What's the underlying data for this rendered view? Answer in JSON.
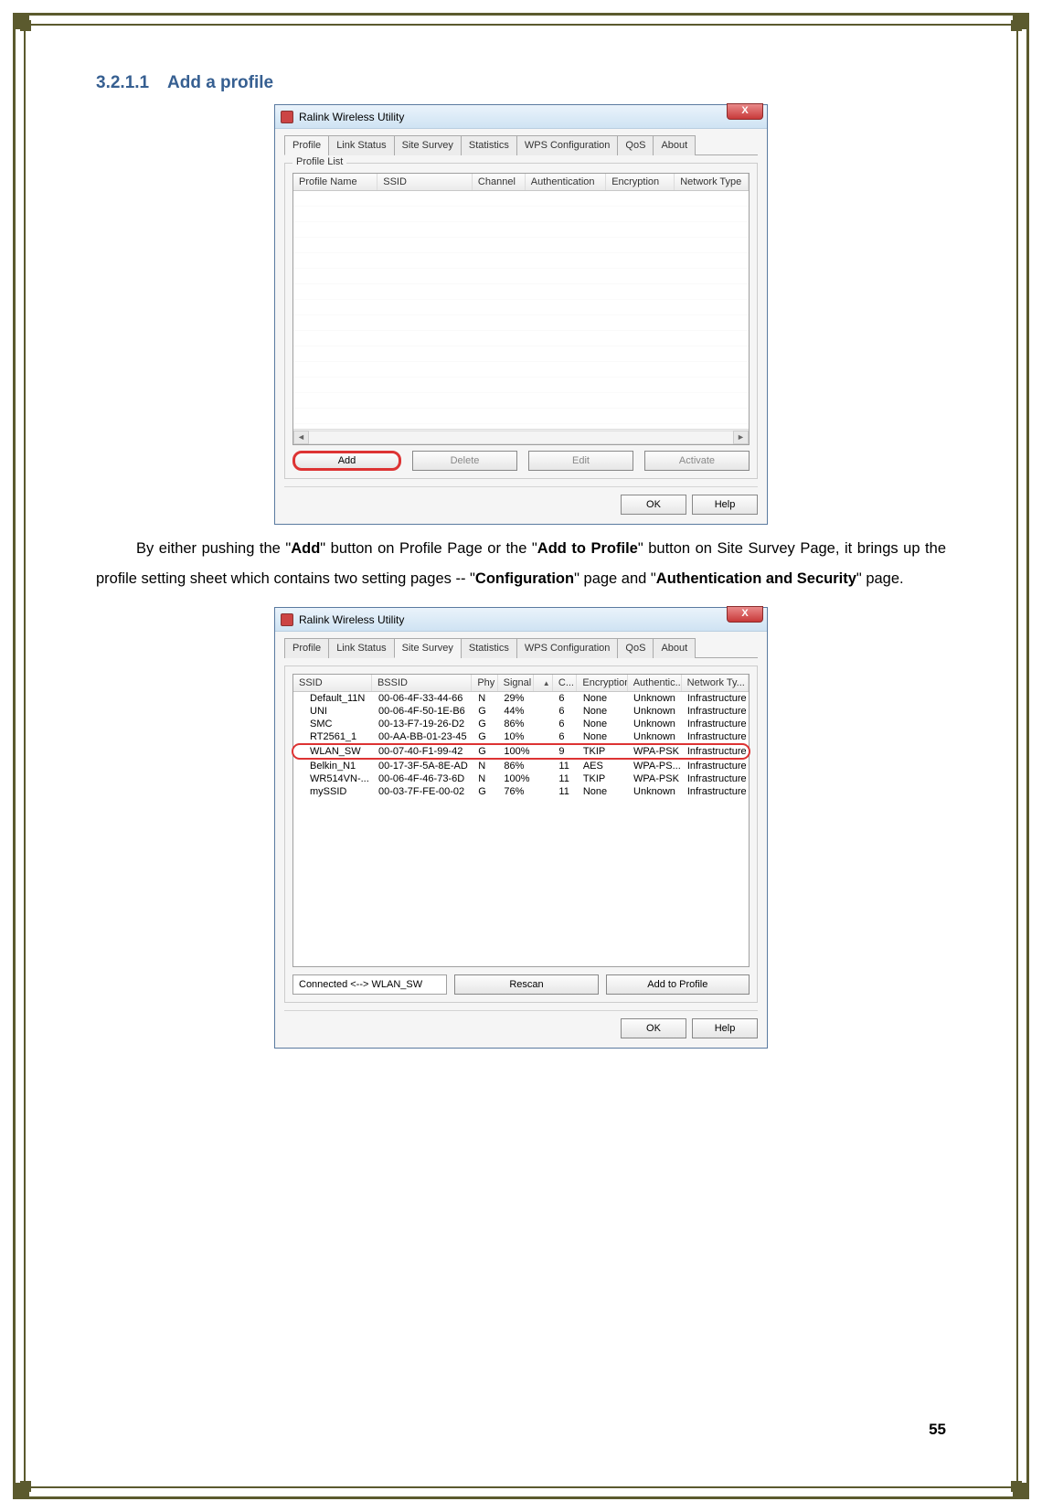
{
  "section": {
    "number": "3.2.1.1",
    "title": "Add a profile"
  },
  "paragraph": {
    "t1": "By either pushing the \"",
    "b1": "Add",
    "t2": "\" button on Profile Page or the \"",
    "b2": "Add to Profile",
    "t3": "\" button on Site Survey Page, it brings up the profile setting sheet which contains two setting pages -- \"",
    "b3": "Configuration",
    "t4": "\" page and \"",
    "b4": "Authentication and Security",
    "t5": "\" page."
  },
  "page_number": "55",
  "win1": {
    "title": "Ralink Wireless Utility",
    "close": "X",
    "tabs": [
      "Profile",
      "Link Status",
      "Site Survey",
      "Statistics",
      "WPS Configuration",
      "QoS",
      "About"
    ],
    "active_tab": "Profile",
    "group_label": "Profile List",
    "columns": [
      "Profile Name",
      "SSID",
      "Channel",
      "Authentication",
      "Encryption",
      "Network Type"
    ],
    "buttons": {
      "add": "Add",
      "delete": "Delete",
      "edit": "Edit",
      "activate": "Activate"
    },
    "footer": {
      "ok": "OK",
      "help": "Help"
    }
  },
  "win2": {
    "title": "Ralink Wireless Utility",
    "close": "X",
    "tabs": [
      "Profile",
      "Link Status",
      "Site Survey",
      "Statistics",
      "WPS Configuration",
      "QoS",
      "About"
    ],
    "active_tab": "Site Survey",
    "columns": [
      "SSID",
      "BSSID",
      "Phy",
      "Signal",
      "",
      "C...",
      "Encryption",
      "Authentic...",
      "Network Ty..."
    ],
    "rows": [
      {
        "ssid": "Default_11N",
        "bssid": "00-06-4F-33-44-66",
        "phy": "N",
        "signal": "29%",
        "sort": "",
        "c": "6",
        "enc": "None",
        "auth": "Unknown",
        "nt": "Infrastructure"
      },
      {
        "ssid": "UNI",
        "bssid": "00-06-4F-50-1E-B6",
        "phy": "G",
        "signal": "44%",
        "sort": "",
        "c": "6",
        "enc": "None",
        "auth": "Unknown",
        "nt": "Infrastructure"
      },
      {
        "ssid": "SMC",
        "bssid": "00-13-F7-19-26-D2",
        "phy": "G",
        "signal": "86%",
        "sort": "",
        "c": "6",
        "enc": "None",
        "auth": "Unknown",
        "nt": "Infrastructure"
      },
      {
        "ssid": "RT2561_1",
        "bssid": "00-AA-BB-01-23-45",
        "phy": "G",
        "signal": "10%",
        "sort": "",
        "c": "6",
        "enc": "None",
        "auth": "Unknown",
        "nt": "Infrastructure"
      },
      {
        "ssid": "WLAN_SW",
        "bssid": "00-07-40-F1-99-42",
        "phy": "G",
        "signal": "100%",
        "sort": "",
        "c": "9",
        "enc": "TKIP",
        "auth": "WPA-PSK",
        "nt": "Infrastructure",
        "highlight": true
      },
      {
        "ssid": "Belkin_N1",
        "bssid": "00-17-3F-5A-8E-AD",
        "phy": "N",
        "signal": "86%",
        "sort": "",
        "c": "11",
        "enc": "AES",
        "auth": "WPA-PS...",
        "nt": "Infrastructure"
      },
      {
        "ssid": "WR514VN-...",
        "bssid": "00-06-4F-46-73-6D",
        "phy": "N",
        "signal": "100%",
        "sort": "",
        "c": "11",
        "enc": "TKIP",
        "auth": "WPA-PSK",
        "nt": "Infrastructure"
      },
      {
        "ssid": "mySSID",
        "bssid": "00-03-7F-FE-00-02",
        "phy": "G",
        "signal": "76%",
        "sort": "",
        "c": "11",
        "enc": "None",
        "auth": "Unknown",
        "nt": "Infrastructure"
      }
    ],
    "status": "Connected <--> WLAN_SW",
    "buttons": {
      "rescan": "Rescan",
      "add": "Add to Profile"
    },
    "footer": {
      "ok": "OK",
      "help": "Help"
    }
  },
  "col_w1": [
    96,
    108,
    60,
    92,
    78,
    84
  ],
  "col_w2": [
    94,
    120,
    30,
    42,
    22,
    28,
    60,
    64,
    80
  ]
}
